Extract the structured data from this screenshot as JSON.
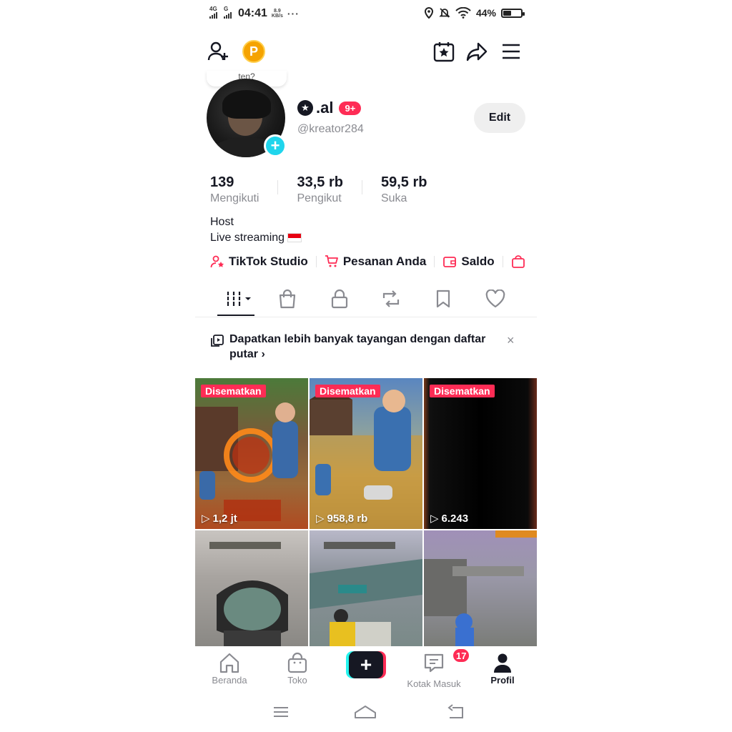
{
  "status_bar": {
    "net1": "4G",
    "net2": "G",
    "time": "04:41",
    "speed_value": "8.9",
    "speed_unit": "KB/s",
    "dots": "···",
    "battery_percent": "44%",
    "battery_level": 0.44
  },
  "header": {
    "coin_label": "P"
  },
  "profile": {
    "bubble_text": "ten?",
    "name": ".al",
    "notif_count": "9+",
    "handle": "@kreator284",
    "edit_label": "Edit",
    "stats": [
      {
        "value": "139",
        "label": "Mengikuti"
      },
      {
        "value": "33,5 rb",
        "label": "Pengikut"
      },
      {
        "value": "59,5 rb",
        "label": "Suka"
      }
    ],
    "bio_line1": "Host",
    "bio_line2": "Live streaming"
  },
  "quick_links": [
    {
      "label": "TikTok Studio",
      "icon": "person-star-icon"
    },
    {
      "label": "Pesanan Anda",
      "icon": "cart-icon"
    },
    {
      "label": "Saldo",
      "icon": "wallet-icon"
    }
  ],
  "tabs": [
    "videos",
    "shop",
    "private",
    "reposts",
    "favorites",
    "liked"
  ],
  "banner": {
    "text": "Dapatkan lebih banyak tayangan dengan daftar putar",
    "close": "×"
  },
  "videos": [
    {
      "pinned": "Disematkan",
      "views": "1,2 jt"
    },
    {
      "pinned": "Disematkan",
      "views": "958,8 rb"
    },
    {
      "pinned": "Disematkan",
      "views": "6.243"
    },
    {
      "pinned": "",
      "views": ""
    },
    {
      "pinned": "",
      "views": ""
    },
    {
      "pinned": "",
      "views": ""
    }
  ],
  "bottom_nav": {
    "home": "Beranda",
    "shop": "Toko",
    "create": "+",
    "inbox": "Kotak Masuk",
    "inbox_badge": "17",
    "profile": "Profil"
  },
  "colors": {
    "accent": "#fe2c55",
    "cyan": "#25f4ee",
    "text": "#161823",
    "muted": "#8a8b91"
  }
}
